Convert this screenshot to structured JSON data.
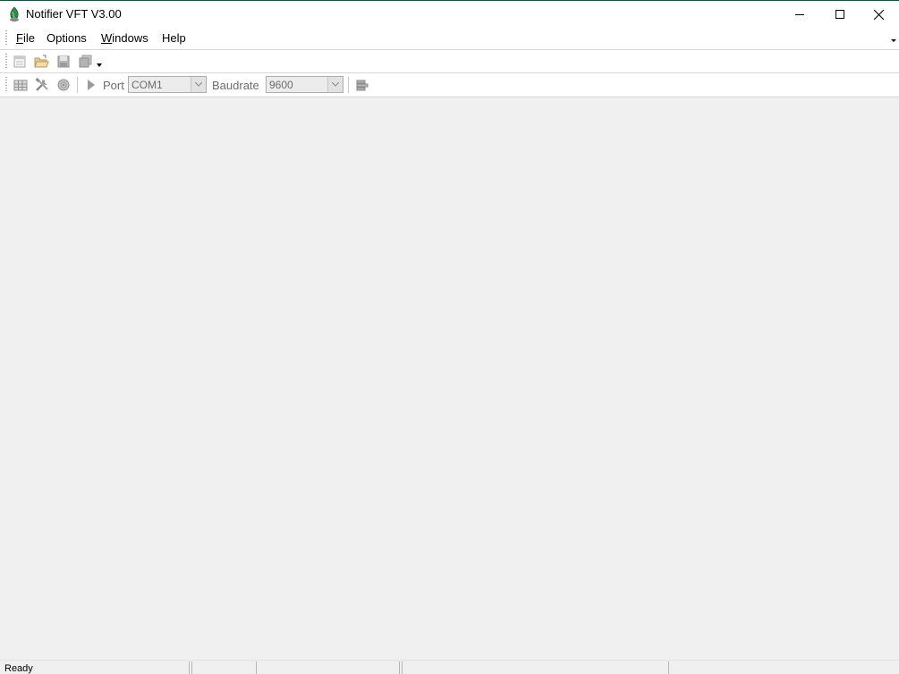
{
  "window": {
    "title": "Notifier VFT V3.00",
    "icon": "notifier-app-icon",
    "controls": [
      "minimize-icon",
      "maximize-icon",
      "close-icon"
    ]
  },
  "menu": {
    "items": [
      {
        "label": "File",
        "mnemonic": "F"
      },
      {
        "label": "Options",
        "mnemonic": ""
      },
      {
        "label": "Windows",
        "mnemonic": "W"
      },
      {
        "label": "Help",
        "mnemonic": ""
      }
    ]
  },
  "toolbar1": {
    "icons": [
      "new-document-icon",
      "open-folder-icon",
      "save-icon",
      "save-all-icon"
    ]
  },
  "toolbar2": {
    "port_label": "Port",
    "port_value": "COM1",
    "baud_label": "Baudrate",
    "baud_value": "9600",
    "icons": [
      "grid-icon",
      "tools-icon",
      "disc-icon",
      "play-icon",
      "connect-icon"
    ]
  },
  "status": {
    "text": "Ready"
  },
  "colors": {
    "accent": "#2f8a4a",
    "background": "#f0f0f0"
  }
}
